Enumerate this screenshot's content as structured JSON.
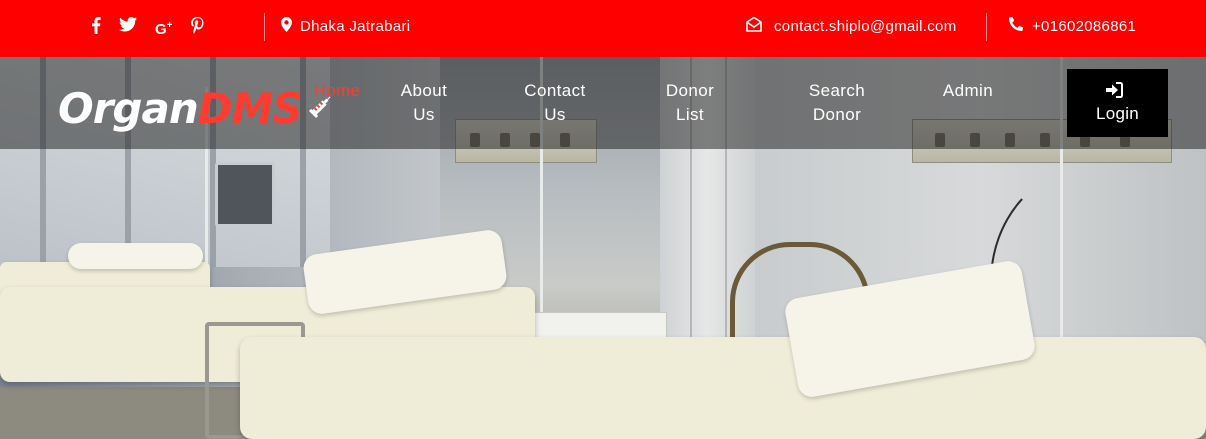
{
  "topbar": {
    "social": [
      {
        "name": "facebook-icon",
        "glyph": "f"
      },
      {
        "name": "twitter-icon",
        "glyph": ""
      },
      {
        "name": "google-plus-icon",
        "glyph": "G+"
      },
      {
        "name": "pinterest-icon",
        "glyph": ""
      }
    ],
    "location_icon": "map-marker-icon",
    "location": "Dhaka Jatrabari",
    "email_icon": "envelope-open-icon",
    "email": "contact.shiplo@gmail.com",
    "phone_icon": "phone-icon",
    "phone": "+01602086861",
    "bg_color": "#ff0000"
  },
  "brand": {
    "part1": "Organ",
    "part2": "DMS",
    "icon": "syringe-icon",
    "accent_color": "#ff3b2f"
  },
  "nav": {
    "items": [
      {
        "label_l1": "Home",
        "label_l2": "",
        "active": true
      },
      {
        "label_l1": "About",
        "label_l2": "Us",
        "active": false
      },
      {
        "label_l1": "Contact",
        "label_l2": "Us",
        "active": false
      },
      {
        "label_l1": "Donor",
        "label_l2": "List",
        "active": false
      },
      {
        "label_l1": "Search",
        "label_l2": "Donor",
        "active": false
      },
      {
        "label_l1": "Admin",
        "label_l2": "",
        "active": false
      }
    ],
    "login": {
      "label": "Login",
      "icon": "sign-in-icon"
    }
  }
}
